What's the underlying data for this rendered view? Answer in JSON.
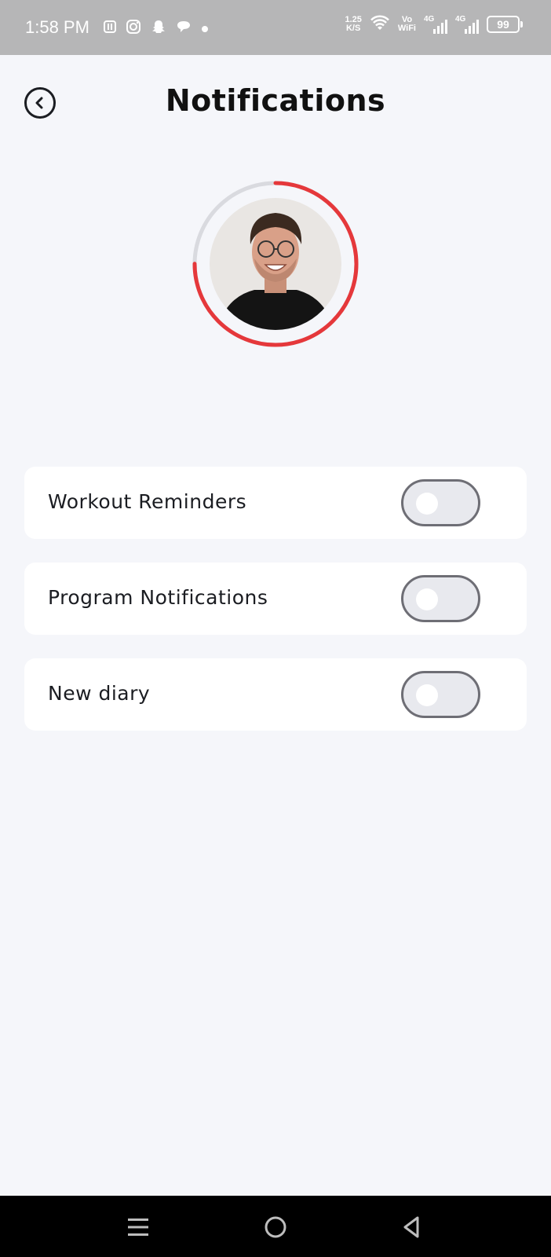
{
  "status_bar": {
    "time": "1:58 PM",
    "left_icons": [
      "paytm-icon",
      "instagram-icon",
      "snapchat-icon",
      "chat-bubble-icon",
      "dot-icon"
    ],
    "net_speed_value": "1.25",
    "net_speed_unit": "K/S",
    "vowifi_top": "Vo",
    "vowifi_bottom": "WiFi",
    "signal1_label": "4G",
    "signal2_label": "4G",
    "battery": "99"
  },
  "header": {
    "title": "Notifications",
    "back_icon": "chevron-left-circle-icon"
  },
  "profile": {
    "progress_color": "#e5383b",
    "track_color": "#d9dadf",
    "progress_fraction": 0.75
  },
  "settings": [
    {
      "label": "Workout Reminders",
      "enabled": false
    },
    {
      "label": "Program Notifications",
      "enabled": false
    },
    {
      "label": "New diary",
      "enabled": false
    }
  ],
  "nav_bar": {
    "buttons": [
      "menu-icon",
      "home-circle-icon",
      "back-triangle-icon"
    ]
  }
}
